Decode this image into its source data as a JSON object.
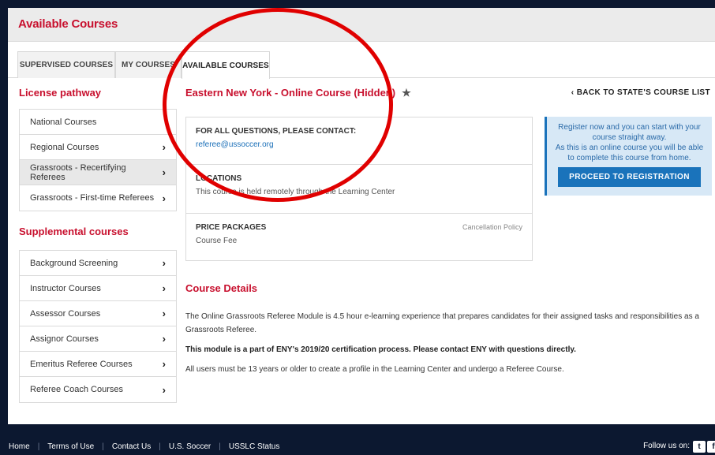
{
  "header": {
    "title": "Available Courses"
  },
  "tabs": [
    {
      "label": "SUPERVISED COURSES"
    },
    {
      "label": "MY COURSES"
    },
    {
      "label": "AVAILABLE COURSES"
    }
  ],
  "sidebar": {
    "license_heading": "License pathway",
    "license_items": [
      {
        "label": "National Courses"
      },
      {
        "label": "Regional Courses",
        "chevron": "›"
      },
      {
        "label": "Grassroots - Recertifying Referees",
        "chevron": "›"
      },
      {
        "label": "Grassroots - First-time Referees",
        "chevron": "›"
      }
    ],
    "supplemental_heading": "Supplemental courses",
    "supplemental_items": [
      {
        "label": "Background Screening",
        "chevron": "›"
      },
      {
        "label": "Instructor Courses",
        "chevron": "›"
      },
      {
        "label": "Assessor Courses",
        "chevron": "›"
      },
      {
        "label": "Assignor Courses",
        "chevron": "›"
      },
      {
        "label": "Emeritus Referee Courses",
        "chevron": "›"
      },
      {
        "label": "Referee Coach Courses",
        "chevron": "›"
      }
    ]
  },
  "main": {
    "course_title": "Eastern New York - Online Course (Hidden)",
    "star_icon": "★",
    "back_link": "‹ BACK TO STATE'S COURSE LIST",
    "contact_label": "FOR ALL QUESTIONS, PLEASE CONTACT:",
    "contact_email": "referee@ussoccer.org",
    "locations_label": "LOCATIONS",
    "locations_value": "This course is held remotely through the Learning Center",
    "price_label": "PRICE PACKAGES",
    "cancellation_link": "Cancellation Policy",
    "price_value": "Course Fee",
    "register_text_1": "Register now and you can start with your course straight away.",
    "register_text_2": "As this is an online course you will be able to complete this course from home.",
    "register_button": "PROCEED TO REGISTRATION",
    "details_heading": "Course Details",
    "details_p1": "The Online Grassroots Referee Module is 4.5 hour e-learning experience that prepares candidates for their assigned tasks and responsibilities as a Grassroots Referee.",
    "details_p2": "This module is a part of ENY's 2019/20 certification process. Please contact ENY with questions directly.",
    "details_p3": "All users must be 13 years or older to create a profile in the Learning Center and undergo a Referee Course."
  },
  "footer": {
    "links": [
      "Home",
      "Terms of Use",
      "Contact Us",
      "U.S. Soccer",
      "USSLC Status"
    ],
    "follow_label": "Follow us on:",
    "twitter_icon": "t",
    "other_icon": "f"
  },
  "colors": {
    "accent_red": "#c8102e",
    "link_blue": "#1a6fb8",
    "footer_bg": "#0c1830",
    "register_bg": "#d7e8f6"
  }
}
